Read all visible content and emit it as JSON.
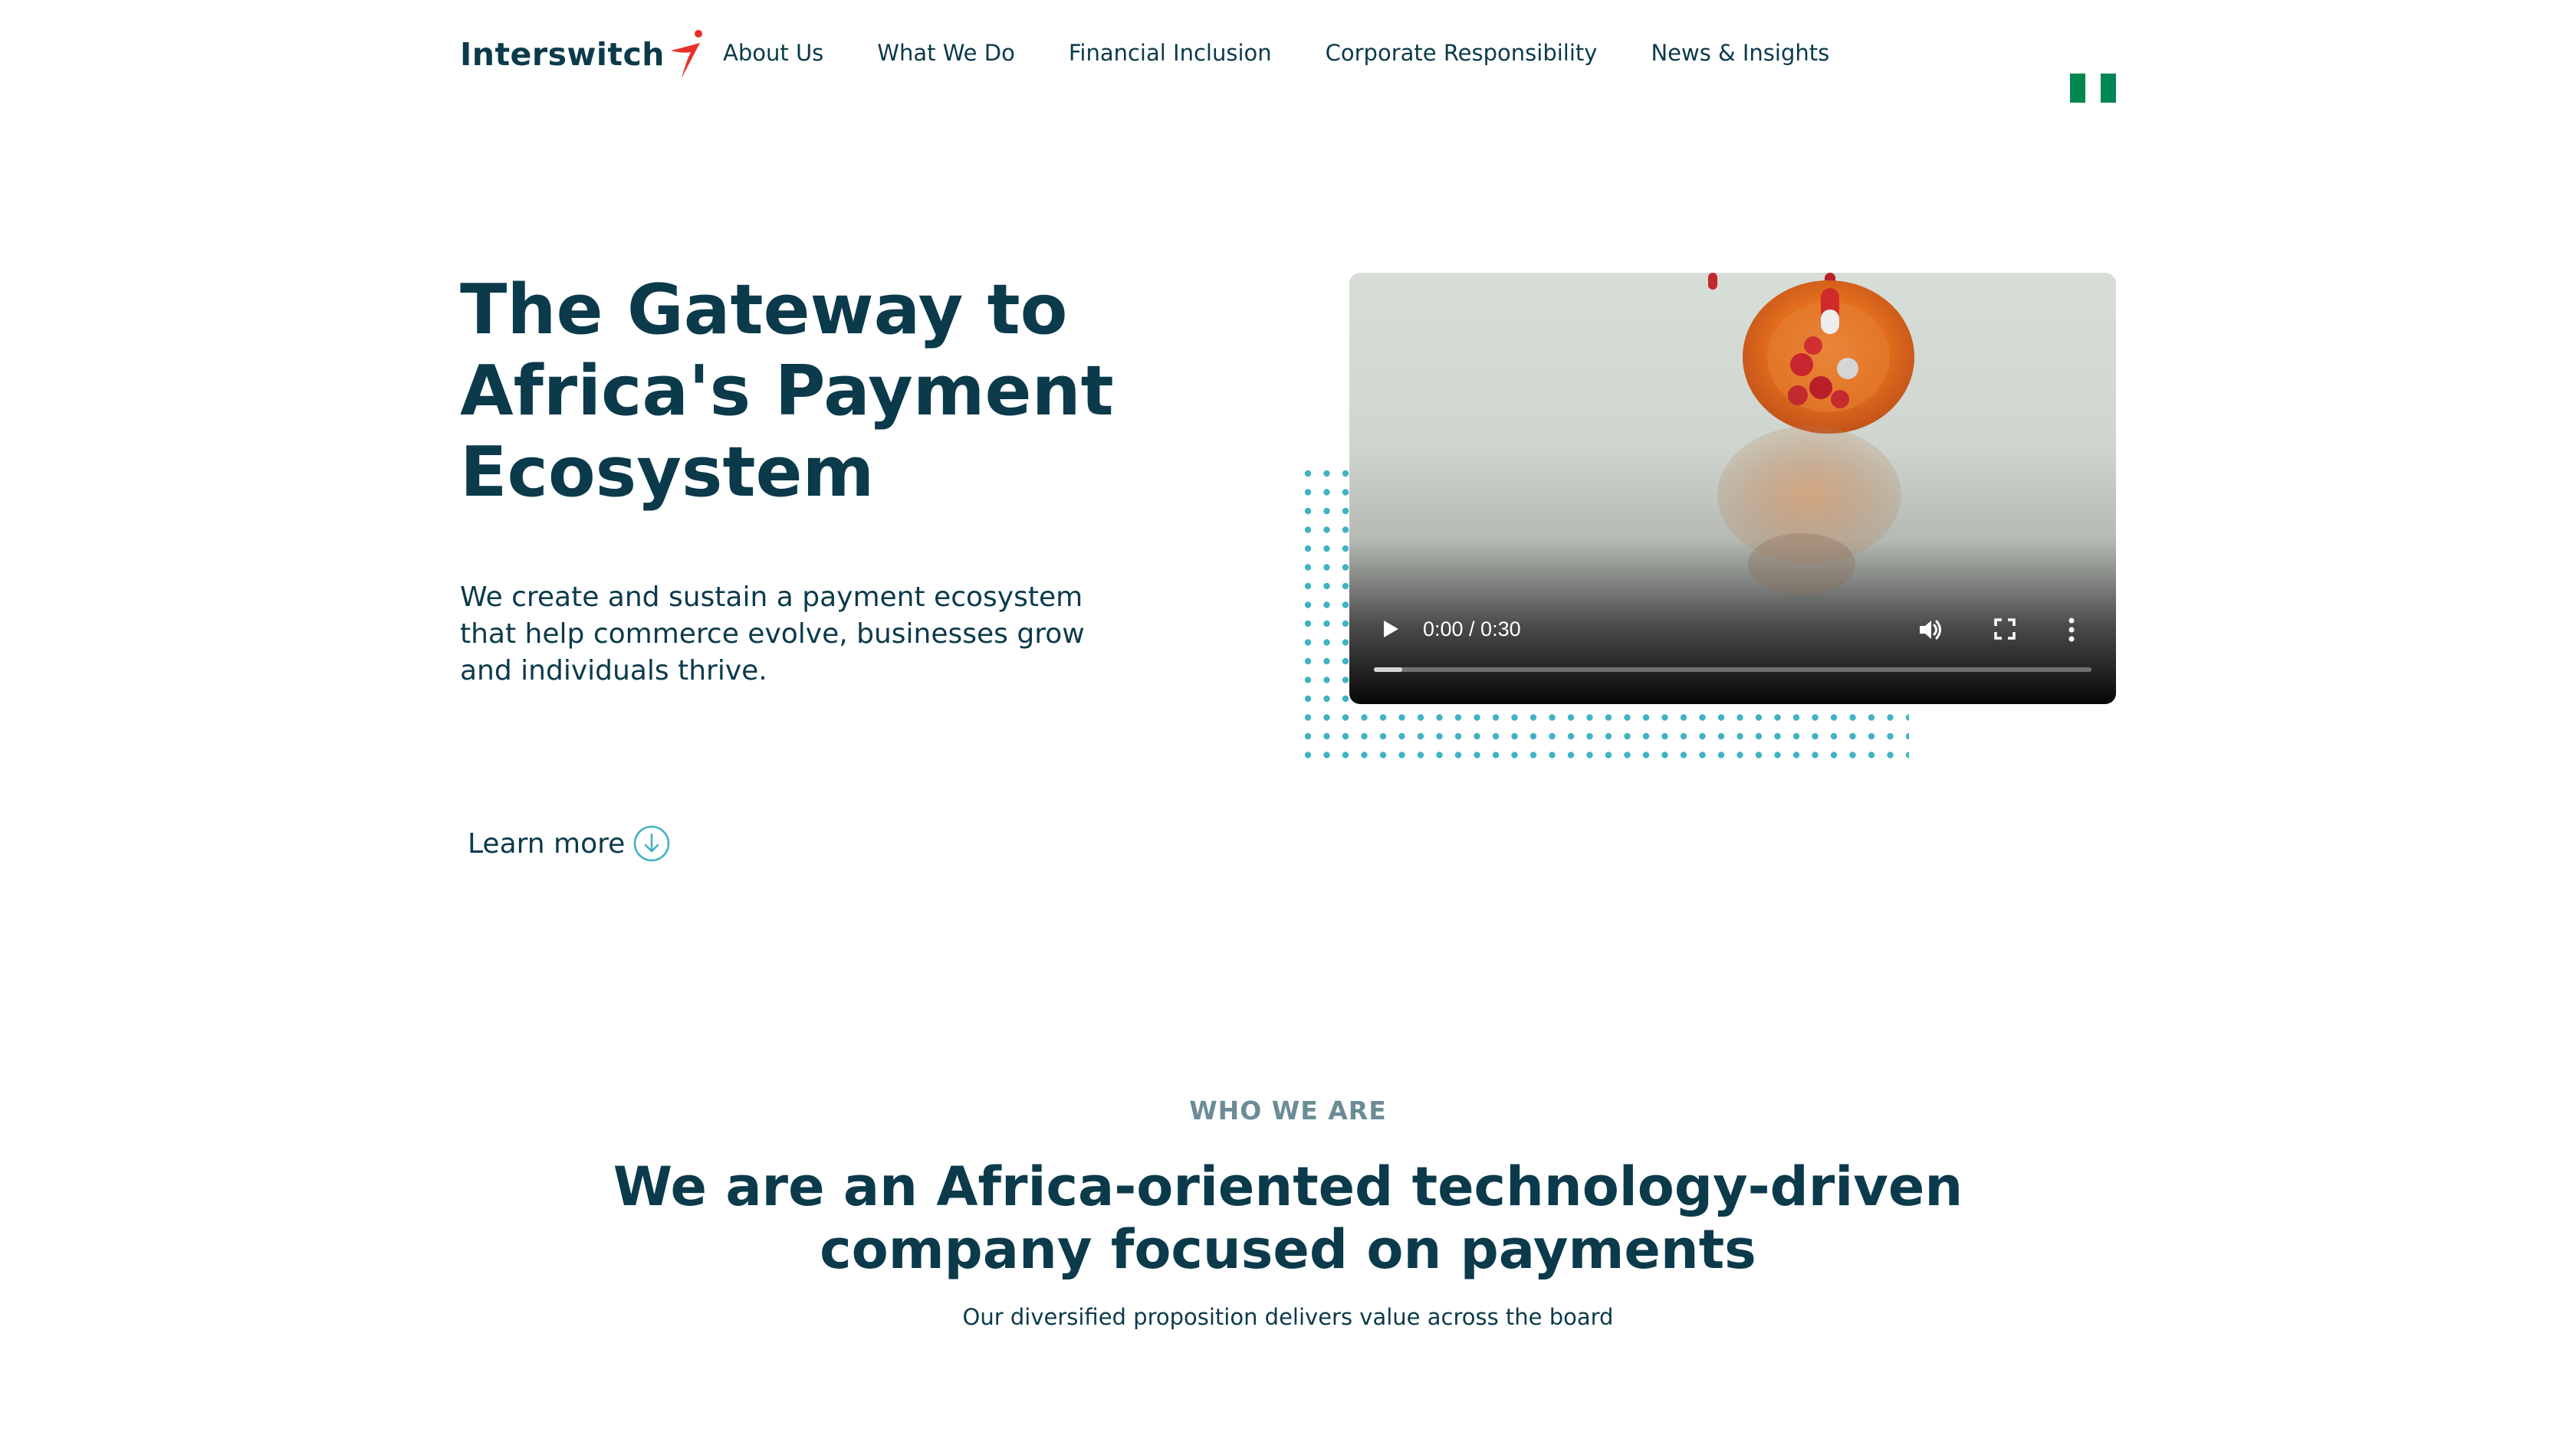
{
  "brand": {
    "name": "Interswitch",
    "primary_color": "#0b3a4b",
    "accent_color": "#e8312a",
    "dot_color": "#3fb3c3"
  },
  "nav": {
    "items": [
      {
        "label": "About Us"
      },
      {
        "label": "What We Do"
      },
      {
        "label": "Financial Inclusion"
      },
      {
        "label": "Corporate Responsibility"
      },
      {
        "label": "News & Insights"
      }
    ],
    "country_flag_icon": "nigeria-flag-icon"
  },
  "hero": {
    "title_lines": [
      "The Gateway to",
      "Africa's Payment",
      "Ecosystem"
    ],
    "description": "We create and sustain a payment ecosystem that help commerce evolve, businesses grow and individuals thrive.",
    "learn_more_label": "Learn more",
    "learn_more_icon": "arrow-down-circle-icon"
  },
  "video": {
    "time_display": "0:00 / 0:30",
    "progress_fraction": 0.04,
    "controls": [
      "play-icon",
      "volume-icon",
      "fullscreen-icon",
      "more-options-icon"
    ]
  },
  "who_we_are": {
    "eyebrow": "WHO WE ARE",
    "title_lines": [
      "We are an Africa-oriented technology-driven",
      "company focused on payments"
    ],
    "subtitle": "Our diversified proposition delivers value across the board"
  }
}
